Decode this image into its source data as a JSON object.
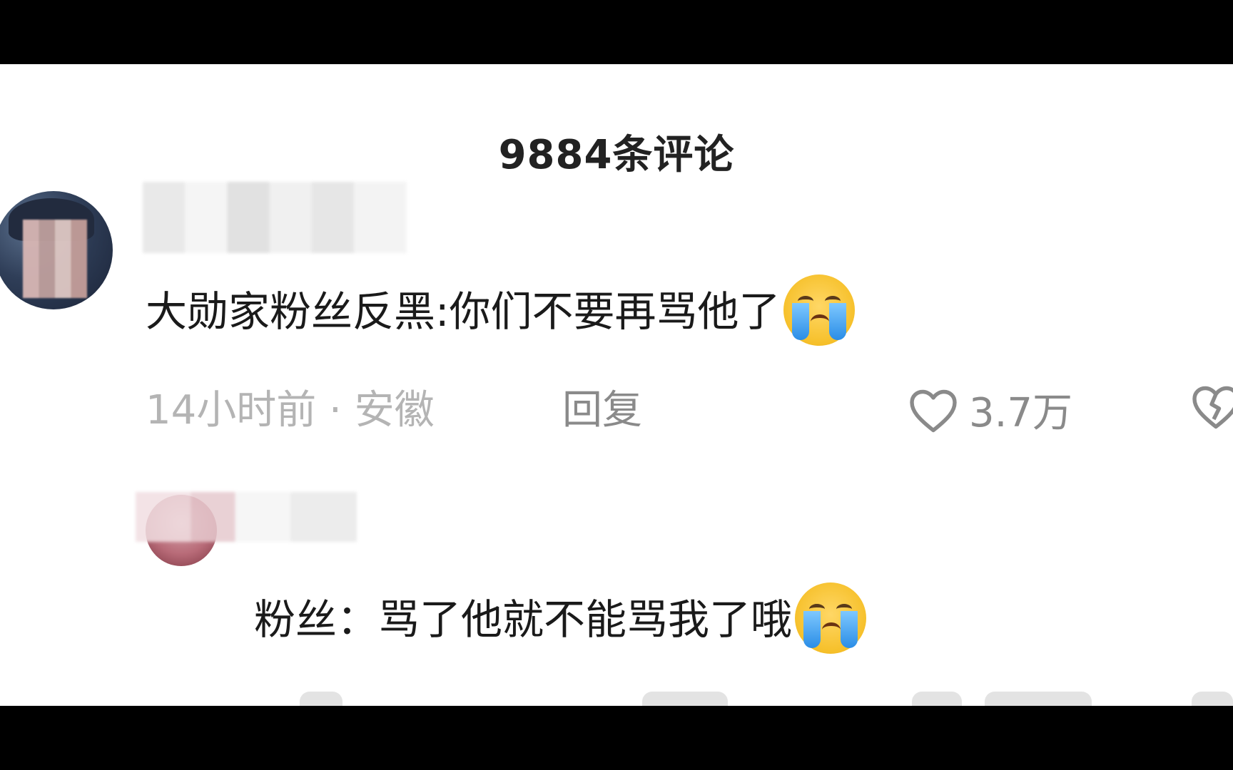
{
  "header": {
    "comment_count_title": "9884条评论"
  },
  "comments": [
    {
      "username": "",
      "text": "大勋家粉丝反黑:你们不要再骂他了",
      "emoji": "loudly-crying-face",
      "time_location": "14小时前 · 安徽",
      "reply_label": "回复",
      "like_count": "3.7万"
    },
    {
      "username": "",
      "text": "粉丝：骂了他就不能骂我了哦",
      "emoji": "loudly-crying-face"
    }
  ],
  "icons": {
    "like": "heart-outline-icon",
    "dislike": "broken-heart-icon"
  },
  "colors": {
    "background": "#ffffff",
    "letterbox": "#000000",
    "primary_text": "#1a1a1a",
    "secondary_text": "#8a8a8a",
    "meta_text": "#b4b4b4"
  }
}
